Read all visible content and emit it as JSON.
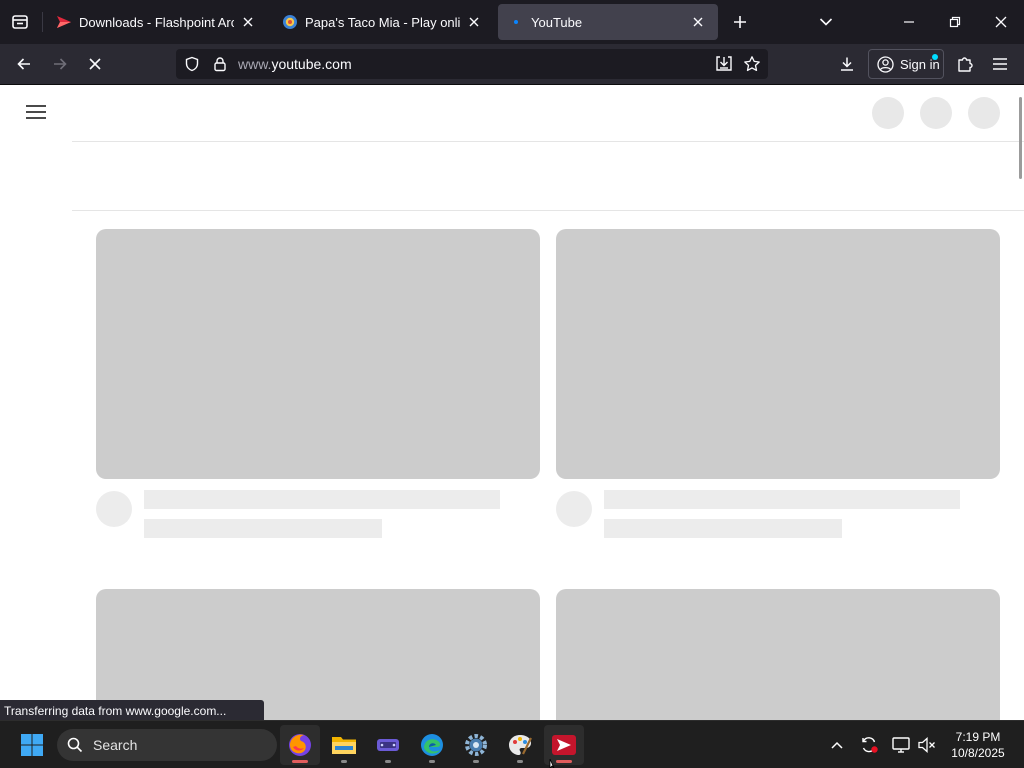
{
  "browser": {
    "tabs": [
      {
        "title": "Downloads - Flashpoint Archive",
        "active": false
      },
      {
        "title": "Papa's Taco Mia - Play online at",
        "active": false
      },
      {
        "title": "YouTube",
        "active": true
      }
    ],
    "url": {
      "prefix": "www.",
      "domain": "youtube.com"
    },
    "sign_in_label": "Sign in",
    "status_text": "Transferring data from www.google.com...",
    "colors": {
      "tab_active": "#42414d",
      "toolbar": "#2b2a33",
      "accent": "#00ddff"
    }
  },
  "taskbar": {
    "search_placeholder": "Search",
    "apps": [
      {
        "name": "firefox-icon",
        "running": true
      },
      {
        "name": "file-explorer-icon",
        "running": false
      },
      {
        "name": "game-controller-icon",
        "running": false
      },
      {
        "name": "edge-icon",
        "running": false
      },
      {
        "name": "settings-gear-icon",
        "running": false
      },
      {
        "name": "paint-icon",
        "running": false
      },
      {
        "name": "flashpoint-icon",
        "running": true
      }
    ],
    "clock": {
      "time": "7:19 PM",
      "date": "10/8/2025"
    }
  }
}
